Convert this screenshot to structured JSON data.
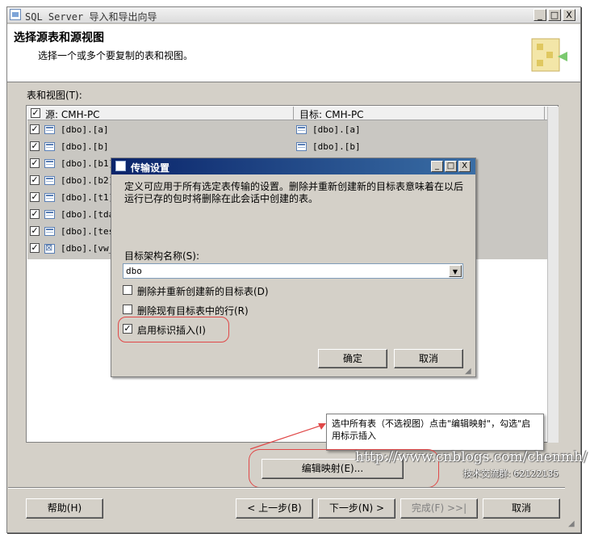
{
  "window": {
    "title": "SQL Server 导入和导出向导",
    "controls": [
      "_",
      "□",
      "X"
    ]
  },
  "header": {
    "title": "选择源表和源视图",
    "subtitle": "选择一个或多个要复制的表和视图。"
  },
  "table_label": "表和视图(T):",
  "grid": {
    "source_header": "源: CMH-PC",
    "dest_header": "目标: CMH-PC",
    "rows": [
      {
        "source": "[dbo].[a]",
        "dest": "[dbo].[a]",
        "checked": true,
        "kind": "table"
      },
      {
        "source": "[dbo].[b]",
        "dest": "[dbo].[b]",
        "checked": true,
        "kind": "table"
      },
      {
        "source": "[dbo].[b1]",
        "dest": "",
        "checked": true,
        "kind": "table"
      },
      {
        "source": "[dbo].[b2]",
        "dest": "",
        "checked": true,
        "kind": "table"
      },
      {
        "source": "[dbo].[t1]",
        "dest": "",
        "checked": true,
        "kind": "table"
      },
      {
        "source": "[dbo].[tda",
        "dest": "",
        "checked": true,
        "kind": "table"
      },
      {
        "source": "[dbo].[tes",
        "dest": "",
        "checked": true,
        "kind": "table"
      },
      {
        "source": "[dbo].[vw_",
        "dest": "",
        "checked": true,
        "kind": "view"
      }
    ]
  },
  "dialog": {
    "title": "传输设置",
    "description": "定义可应用于所有选定表传输的设置。删除并重新创建新的目标表意味着在以后运行已存的包时将删除在此会话中创建的表。",
    "schema_label": "目标架构名称(S):",
    "schema_value": "dbo",
    "options": [
      {
        "label": "删除并重新创建新的目标表(D)",
        "checked": false
      },
      {
        "label": "删除现有目标表中的行(R)",
        "checked": false
      },
      {
        "label": "启用标识插入(I)",
        "checked": true
      }
    ],
    "ok": "确定",
    "cancel": "取消"
  },
  "callout": "选中所有表（不选视图）点击\"编辑映射\"，勾选\"启用标示插入",
  "watermark": {
    "url": "http://www.cnblogs.com/chenmh/",
    "qq": "技术交流群: 62122135"
  },
  "edit_mapping": "编辑映射(E)...",
  "footer": {
    "help": "帮助(H)",
    "back": "< 上一步(B)",
    "next": "下一步(N) >",
    "finish": "完成(F) >>|",
    "cancel": "取消"
  },
  "colors": {
    "dialog_title": "#0a246a",
    "highlight_red": "#e04848",
    "face": "#d4d0c8"
  }
}
